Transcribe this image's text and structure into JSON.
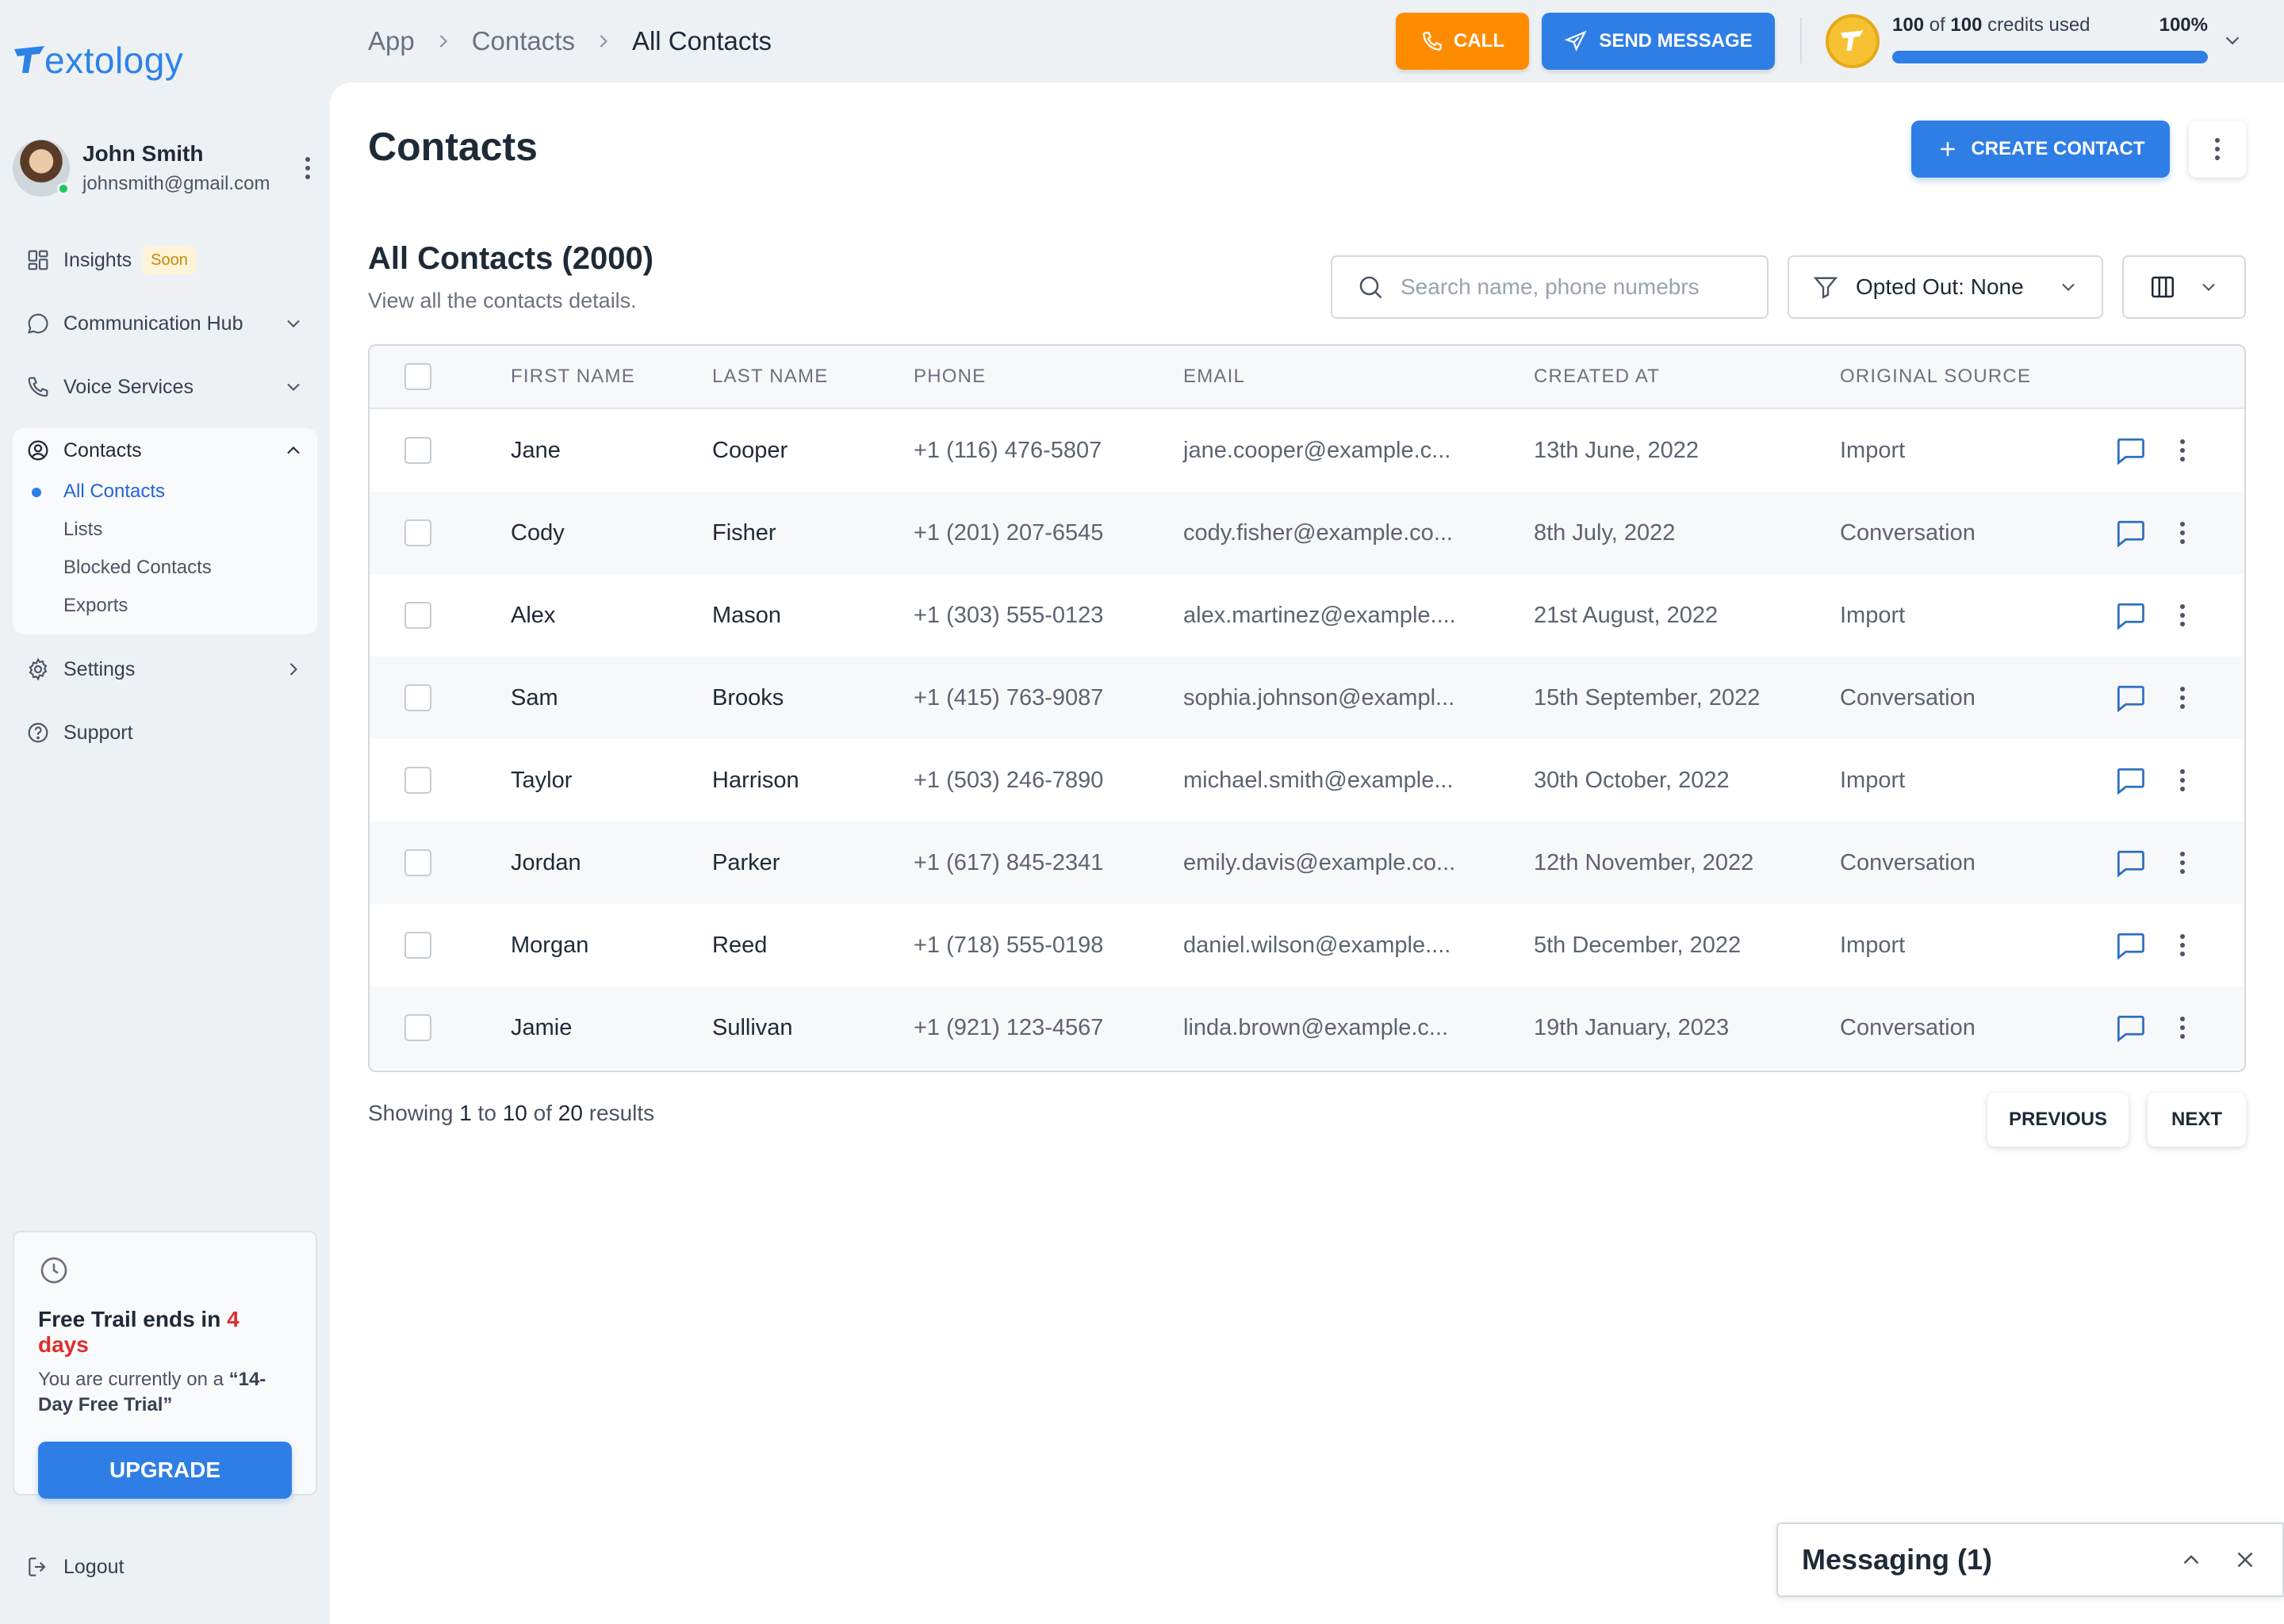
{
  "app": {
    "logo_text": "extology",
    "logo_mark": "T"
  },
  "user": {
    "name": "John Smith",
    "email": "johnsmith@gmail.com"
  },
  "sidebar": {
    "insights_label": "Insights",
    "insights_badge": "Soon",
    "comm_hub_label": "Communication Hub",
    "voice_label": "Voice Services",
    "contacts_label": "Contacts",
    "contacts_sub": {
      "all_contacts": "All Contacts",
      "lists": "Lists",
      "blocked": "Blocked Contacts",
      "exports": "Exports"
    },
    "settings_label": "Settings",
    "support_label": "Support",
    "logout_label": "Logout"
  },
  "trial": {
    "title_prefix": "Free Trail ends in",
    "days": "4 days",
    "text_prefix": "You are currently on a",
    "plan": "“14-Day Free Trial”",
    "upgrade_label": "UPGRADE"
  },
  "topbar": {
    "breadcrumb": [
      "App",
      "Contacts",
      "All Contacts"
    ],
    "call_label": "CALL",
    "send_label": "SEND MESSAGE",
    "credits_used": "100",
    "credits_total": "100",
    "credits_of": "of",
    "credits_suffix": "credits used",
    "credits_percent_label": "100%",
    "credits_fraction": 1.0
  },
  "page": {
    "title": "Contacts",
    "create_label": "CREATE CONTACT",
    "section_title": "All Contacts (2000)",
    "section_subtitle": "View all the contacts details.",
    "search_placeholder": "Search name, phone numebrs",
    "filter_label": "Opted Out: None"
  },
  "table": {
    "columns": [
      "FIRST NAME",
      "LAST NAME",
      "PHONE",
      "EMAIL",
      "CREATED AT",
      "ORIGINAL SOURCE"
    ],
    "rows": [
      {
        "first": "Jane",
        "last": "Cooper",
        "phone": "+1 (116) 476-5807",
        "email": "jane.cooper@example.c...",
        "created": "13th June, 2022",
        "source": "Import"
      },
      {
        "first": "Cody",
        "last": "Fisher",
        "phone": "+1 (201) 207-6545",
        "email": "cody.fisher@example.co...",
        "created": "8th July, 2022",
        "source": "Conversation"
      },
      {
        "first": "Alex",
        "last": "Mason",
        "phone": "+1 (303) 555-0123",
        "email": "alex.martinez@example....",
        "created": "21st August, 2022",
        "source": "Import"
      },
      {
        "first": "Sam",
        "last": "Brooks",
        "phone": "+1 (415) 763-9087",
        "email": "sophia.johnson@exampl...",
        "created": "15th September, 2022",
        "source": "Conversation"
      },
      {
        "first": "Taylor",
        "last": "Harrison",
        "phone": "+1 (503) 246-7890",
        "email": "michael.smith@example...",
        "created": "30th October, 2022",
        "source": "Import"
      },
      {
        "first": "Jordan",
        "last": "Parker",
        "phone": "+1 (617) 845-2341",
        "email": "emily.davis@example.co...",
        "created": "12th November, 2022",
        "source": "Conversation"
      },
      {
        "first": "Morgan",
        "last": "Reed",
        "phone": "+1 (718) 555-0198",
        "email": "daniel.wilson@example....",
        "created": "5th December, 2022",
        "source": "Import"
      },
      {
        "first": "Jamie",
        "last": "Sullivan",
        "phone": "+1 (921) 123-4567",
        "email": "linda.brown@example.c...",
        "created": "19th January, 2023",
        "source": "Conversation"
      }
    ]
  },
  "pagination": {
    "showing": "Showing",
    "from": "1",
    "to_word": "to",
    "to": "10",
    "of_word": "of",
    "total": "20",
    "results": "results",
    "prev_label": "PREVIOUS",
    "next_label": "NEXT"
  },
  "messaging": {
    "label": "Messaging (1)"
  },
  "colors": {
    "primary": "#2f7ee6",
    "call": "#ff8c00",
    "danger": "#e02d2d",
    "soon_badge": "#c48a0f"
  },
  "icons": {
    "insights": "grid-icon",
    "comm_hub": "chat-bubble-icon",
    "voice": "phone-icon",
    "contacts": "user-circle-icon",
    "settings": "gear-icon",
    "support": "help-circle-icon",
    "logout": "logout-icon",
    "trial": "clock-icon",
    "search": "search-icon",
    "filter": "filter-icon",
    "columns": "columns-icon",
    "row_message": "message-icon",
    "row_more": "kebab-icon"
  }
}
